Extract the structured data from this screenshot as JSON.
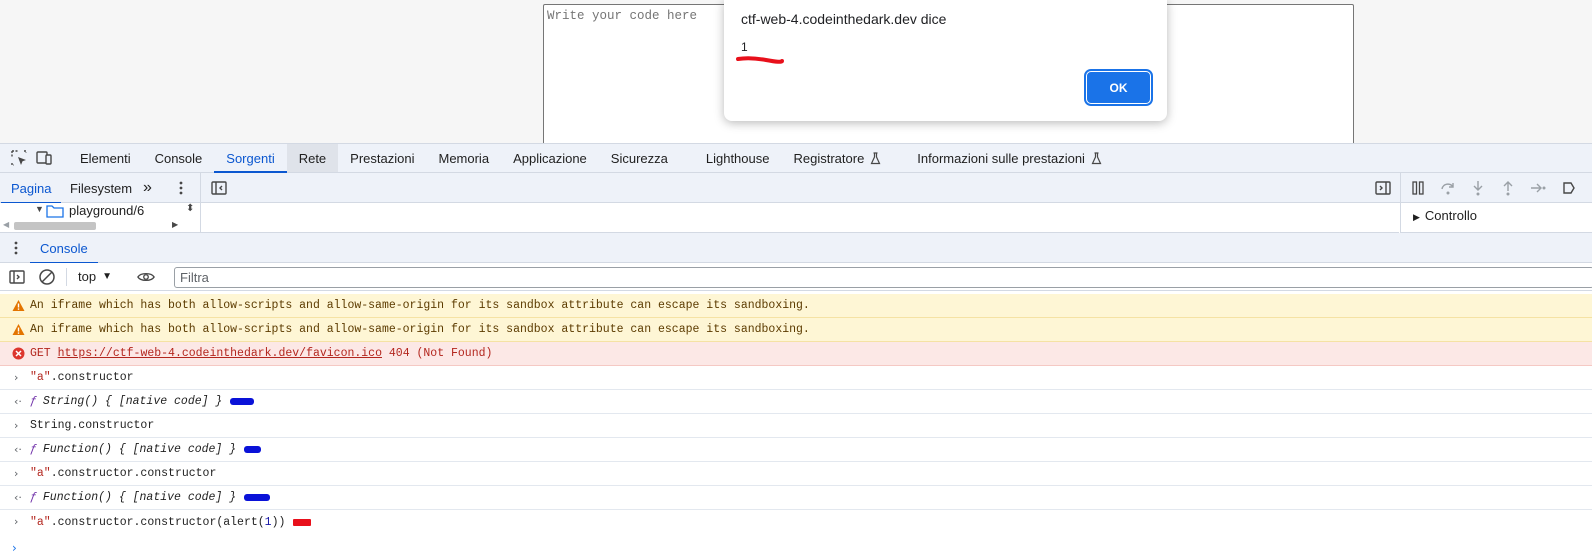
{
  "page": {
    "code_placeholder": "Write your code here"
  },
  "dialog": {
    "title": "ctf-web-4.codeinthedark.dev dice",
    "message": "1",
    "ok_label": "OK"
  },
  "devtools": {
    "tabs": [
      "Elementi",
      "Console",
      "Sorgenti",
      "Rete",
      "Prestazioni",
      "Memoria",
      "Applicazione",
      "Sicurezza",
      "Lighthouse",
      "Registratore",
      "Informazioni sulle prestazioni"
    ],
    "active_tab": "Sorgenti",
    "sources": {
      "nav_tabs": [
        "Pagina",
        "Filesystem"
      ],
      "tree_item": "playground/6",
      "right_section": "Controllo"
    },
    "drawer_tab": "Console",
    "console": {
      "context": "top",
      "filter_placeholder": "Filtra",
      "warning_text": "An iframe which has both allow-scripts and allow-same-origin for its sandbox attribute can escape its sandboxing.",
      "error": {
        "method": "GET",
        "url": "https://ctf-web-4.codeinthedark.dev/favicon.ico",
        "status": "404 (Not Found)"
      },
      "rows": {
        "in1_str": "\"a\"",
        "in1_rest": ".constructor",
        "out1_f": "ƒ",
        "out1_text": "String() { [native code] }",
        "in2": "String.constructor",
        "out2_f": "ƒ",
        "out2_text": "Function() { [native code] }",
        "in3_str": "\"a\"",
        "in3_rest": ".constructor.constructor",
        "out3_f": "ƒ",
        "out3_text": "Function() { [native code] }",
        "in4_str": "\"a\"",
        "in4_mid": ".constructor.constructor(alert(",
        "in4_num": "1",
        "in4_end": "))"
      }
    },
    "colors": {
      "accent": "#0b57d0",
      "redact_red": "#e8101b",
      "redact_blue": "#0a12d8"
    }
  }
}
